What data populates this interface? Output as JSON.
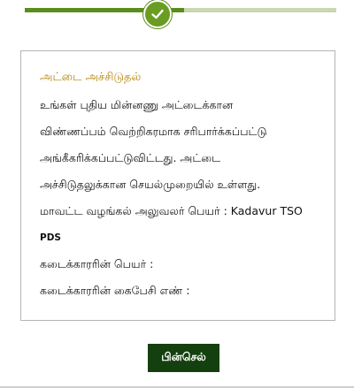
{
  "status_card": {
    "title": "அட்டை அச்சிடுதல்",
    "lines": [
      "உங்கள் புதிய மின்னணு அட்டைக்கான",
      "விண்ணப்பம் வெற்றிகரமாக சரிபார்க்கப்பட்டு",
      "அங்கீகரிக்கப்பட்டுவிட்டது. அட்டை",
      "அச்சிடுதலுக்கான செயல்முறையில் உள்ளது.",
      "மாவட்ட வழங்கல் அலுவலர் பெயர் : Kadavur TSO",
      "PDS",
      "கடைக்காரரின் பெயர் :",
      "கடைக்காரரின் கைபேசி எண் :"
    ]
  },
  "actions": {
    "back_label": "பின்செல்"
  },
  "stepper": {
    "status": "completed",
    "accent": "#5a8d1c"
  },
  "colors": {
    "title": "#b8860b",
    "button_bg": "#14400f",
    "progress": "#5a8d1c"
  }
}
